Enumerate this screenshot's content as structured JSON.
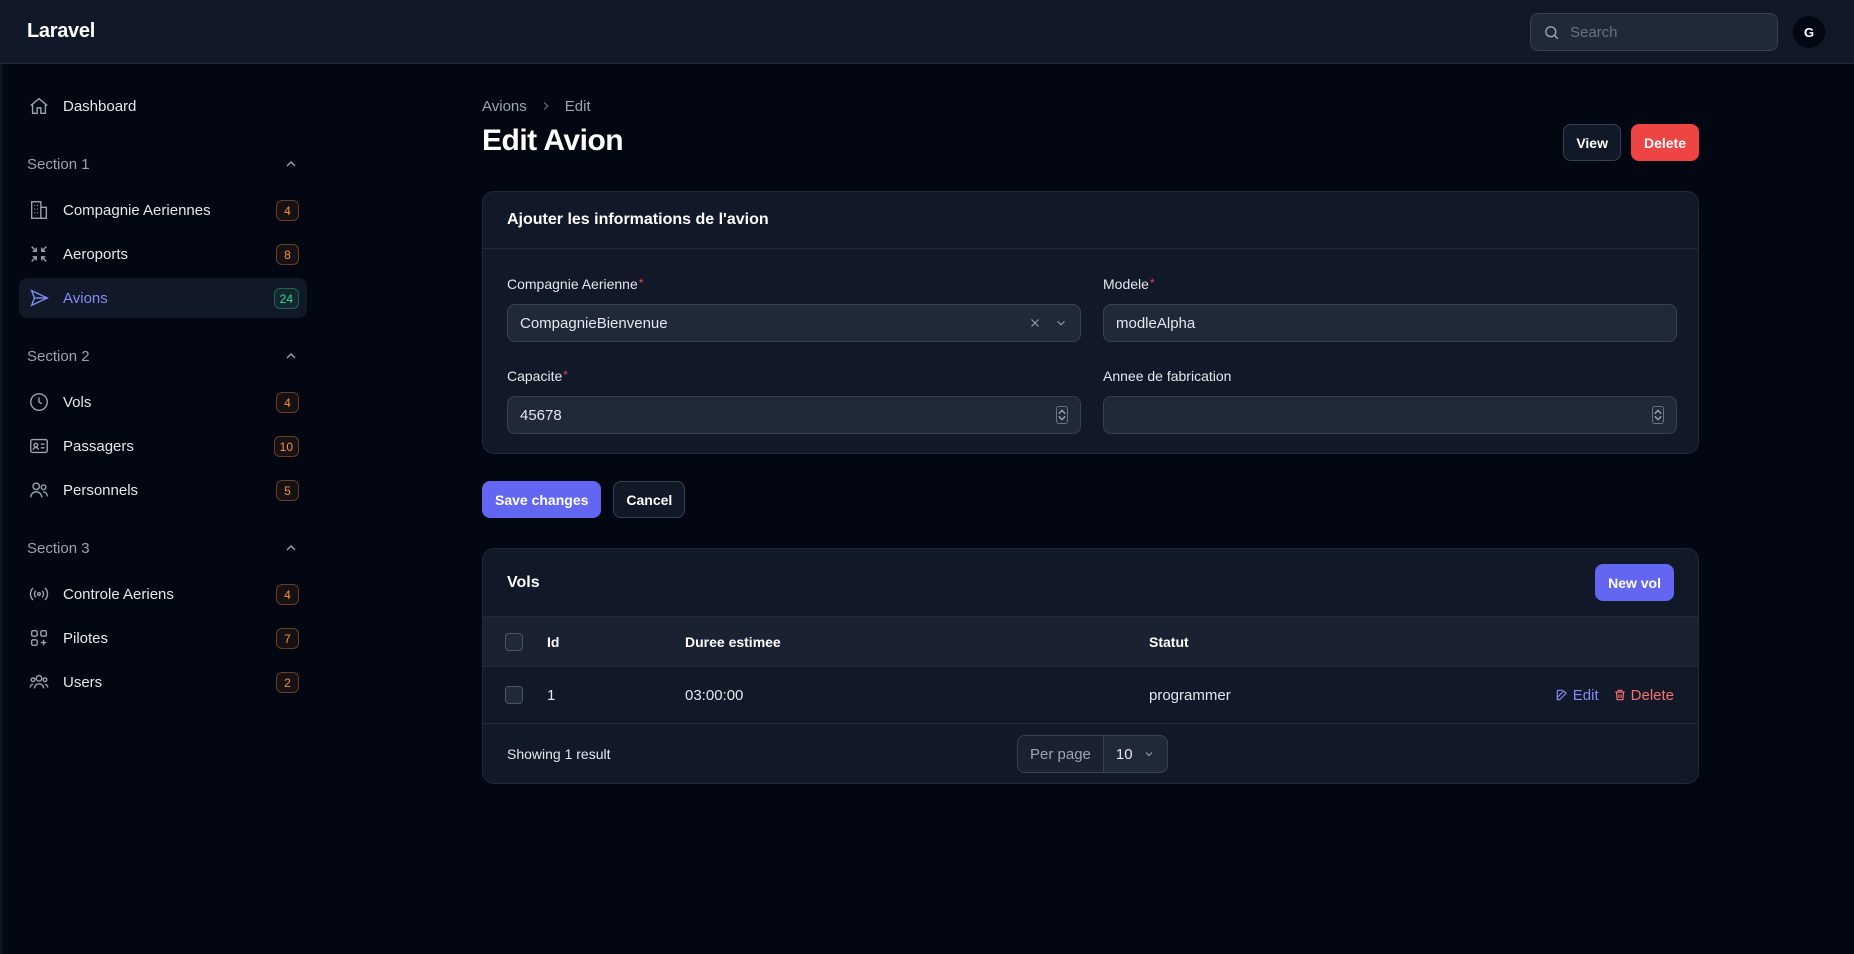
{
  "app": {
    "brand": "Laravel",
    "user_initial": "G"
  },
  "search": {
    "placeholder": "Search"
  },
  "sidebar": {
    "dashboard": {
      "label": "Dashboard"
    },
    "sections": [
      {
        "title": "Section 1",
        "items": [
          {
            "label": "Compagnie Aeriennes",
            "count": "4",
            "icon": "building-icon"
          },
          {
            "label": "Aeroports",
            "count": "8",
            "icon": "arrows-in-icon"
          },
          {
            "label": "Avions",
            "count": "24",
            "icon": "paper-plane-icon",
            "active": true
          }
        ]
      },
      {
        "title": "Section 2",
        "items": [
          {
            "label": "Vols",
            "count": "4",
            "icon": "clock-icon"
          },
          {
            "label": "Passagers",
            "count": "10",
            "icon": "id-card-icon"
          },
          {
            "label": "Personnels",
            "count": "5",
            "icon": "users-icon"
          }
        ]
      },
      {
        "title": "Section 3",
        "items": [
          {
            "label": "Controle Aeriens",
            "count": "4",
            "icon": "signal-icon"
          },
          {
            "label": "Pilotes",
            "count": "7",
            "icon": "squares-plus-icon"
          },
          {
            "label": "Users",
            "count": "2",
            "icon": "user-group-icon"
          }
        ]
      }
    ]
  },
  "breadcrumb": {
    "parent": "Avions",
    "current": "Edit"
  },
  "page": {
    "title": "Edit Avion",
    "view_label": "View",
    "delete_label": "Delete"
  },
  "form": {
    "heading": "Ajouter les informations de l'avion",
    "compagnie": {
      "label": "Compagnie Aerienne",
      "value": "CompagnieBienvenue",
      "required": "*"
    },
    "modele": {
      "label": "Modele",
      "value": "modleAlpha",
      "required": "*"
    },
    "capacite": {
      "label": "Capacite",
      "value": "45678",
      "required": "*"
    },
    "annee": {
      "label": "Annee de fabrication",
      "value": ""
    },
    "save_label": "Save changes",
    "cancel_label": "Cancel"
  },
  "vols": {
    "title": "Vols",
    "new_label": "New vol",
    "columns": {
      "id": "Id",
      "duree": "Duree estimee",
      "statut": "Statut"
    },
    "rows": [
      {
        "id": "1",
        "duree": "03:00:00",
        "statut": "programmer",
        "edit": "Edit",
        "delete": "Delete"
      }
    ],
    "footer": {
      "showing": "Showing 1 result",
      "per_page_label": "Per page",
      "per_page_value": "10"
    }
  }
}
